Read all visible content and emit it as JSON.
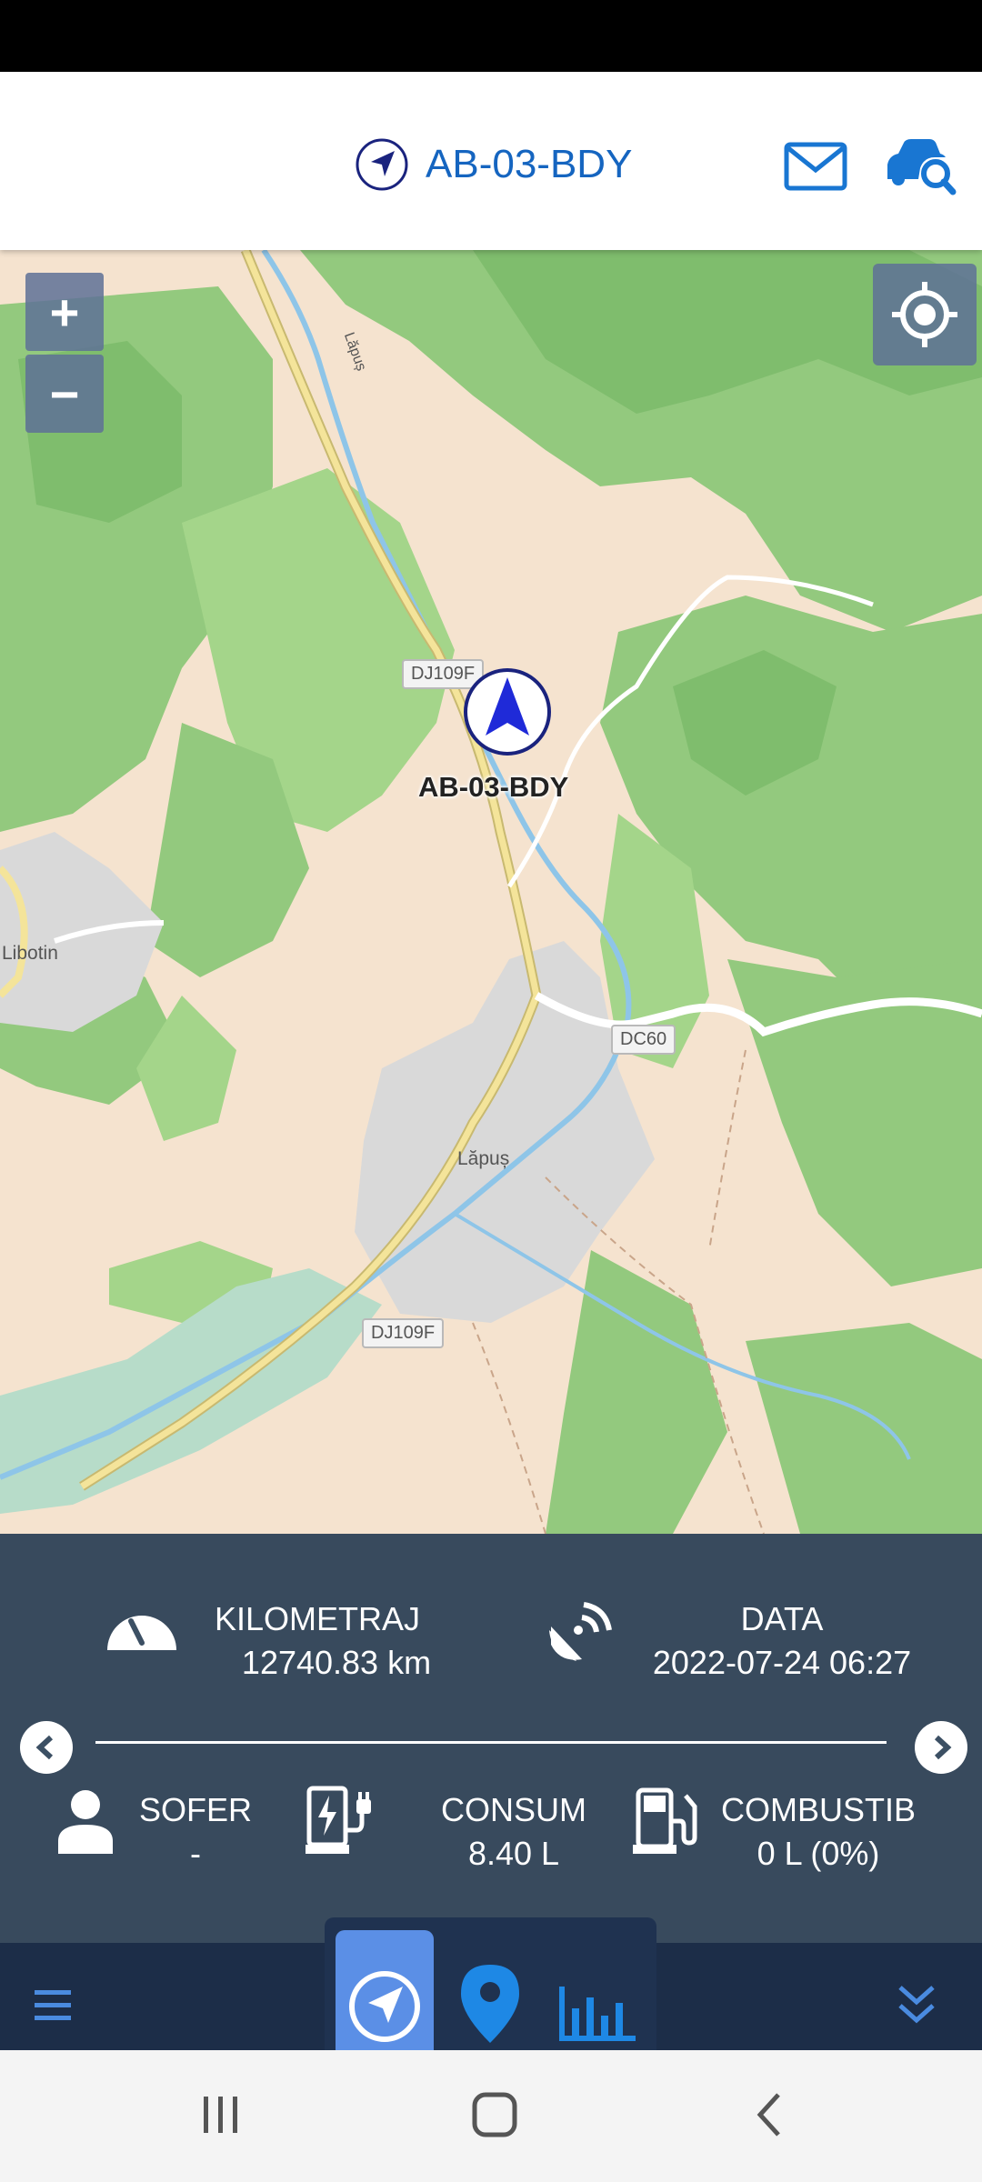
{
  "header": {
    "title": "AB-03-BDY",
    "icons": {
      "title": "navigation-arrow-icon",
      "mail": "mail-icon",
      "car_search": "car-search-icon"
    }
  },
  "map": {
    "zoom_in_label": "+",
    "zoom_out_label": "−",
    "vehicle_label": "AB-03-BDY",
    "place_labels": [
      "Lăpuș",
      "Libotin",
      "Lăpuș"
    ],
    "road_labels": [
      "DJ109F",
      "DC60",
      "DJ109F"
    ],
    "colors": {
      "land": "#f5e3cf",
      "forest": "#93c97e",
      "forest_dark": "#7fbd6d",
      "urban": "#d9d9d9",
      "river": "#8ec5e8",
      "road": "#f4e49a"
    }
  },
  "info": {
    "kilometraj": {
      "label": "KILOMETRAJ",
      "value": "12740.83 km"
    },
    "data": {
      "label": "DATA",
      "value": "2022-07-24 06:27"
    },
    "sofer": {
      "label": "SOFER",
      "value": "-"
    },
    "consum": {
      "label": "CONSUM",
      "value": "8.40 L"
    },
    "combustib": {
      "label": "COMBUSTIB",
      "value": "0 L (0%)"
    }
  },
  "bottom_nav": {
    "tabs": [
      {
        "name": "navigation",
        "icon": "navigation-arrow-icon",
        "active": true
      },
      {
        "name": "location",
        "icon": "map-pin-icon",
        "active": false
      },
      {
        "name": "reports",
        "icon": "bar-chart-icon",
        "active": false
      }
    ]
  },
  "colors": {
    "accent": "#1565c0",
    "panel": "#3c5064",
    "nav": "#1c2d48",
    "tab_active": "#5b8fe6"
  }
}
